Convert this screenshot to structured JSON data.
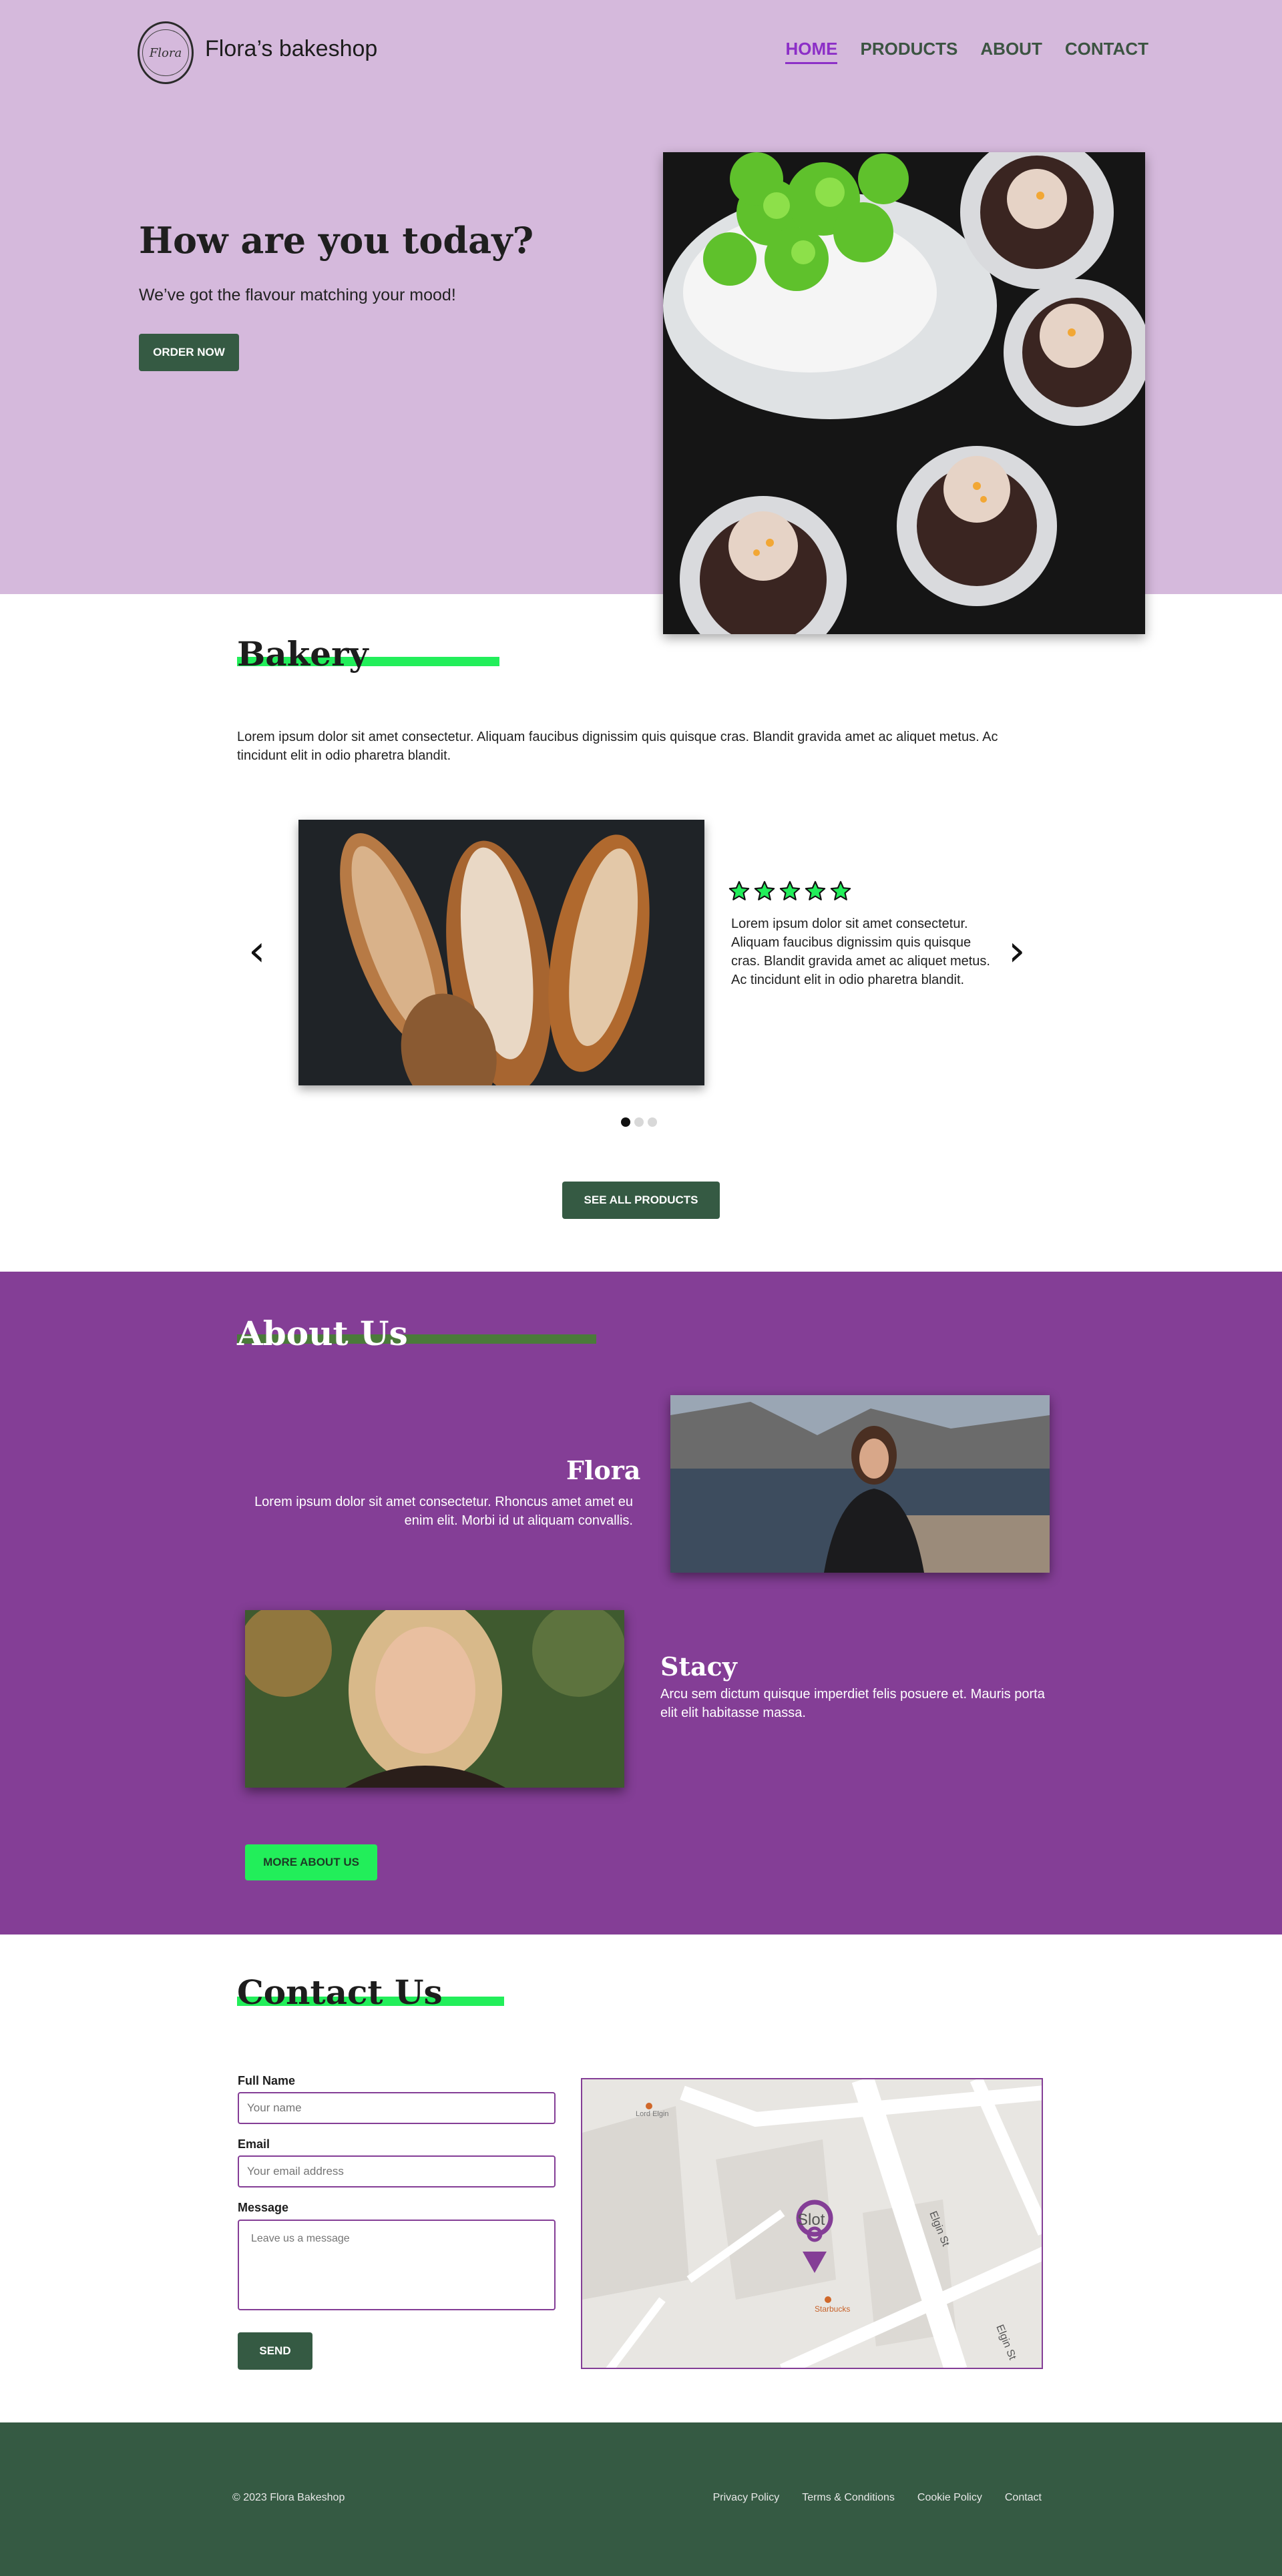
{
  "header": {
    "logo_text": "Flora",
    "brand": "Flora’s bakeshop",
    "nav": [
      "HOME",
      "PRODUCTS",
      "ABOUT",
      "CONTACT"
    ],
    "active_nav": "HOME"
  },
  "hero": {
    "title": "How are you today?",
    "subtitle": "We’ve got the flavour matching your mood!",
    "cta": "ORDER NOW"
  },
  "bakery": {
    "heading": "Bakery",
    "text": "Lorem ipsum dolor sit amet consectetur. Aliquam faucibus dignissim quis quisque cras. Blandit gravida amet ac aliquet metus. Ac tincidunt elit in odio pharetra blandit.",
    "review": {
      "rating": 5,
      "text": "Lorem ipsum dolor sit amet consectetur. Aliquam faucibus dignissim quis quisque cras. Blandit gravida amet ac aliquet metus. Ac tincidunt elit in odio pharetra blandit."
    },
    "slides_total": 3,
    "active_slide": 1,
    "see_all": "SEE ALL PRODUCTS"
  },
  "about": {
    "heading": "About Us",
    "people": [
      {
        "name": "Flora",
        "desc": "Lorem ipsum dolor sit amet consectetur. Rhoncus amet amet eu enim elit. Morbi id ut aliquam convallis."
      },
      {
        "name": "Stacy",
        "desc": "Arcu sem dictum quisque imperdiet felis posuere et. Mauris porta elit elit habitasse massa."
      }
    ],
    "more": "MORE ABOUT US"
  },
  "contact": {
    "heading": "Contact Us",
    "name_label": "Full Name",
    "name_placeholder": "Your name",
    "email_label": "Email",
    "email_placeholder": "Your email address",
    "message_label": "Message",
    "message_placeholder": "Leave us a message",
    "send": "SEND",
    "map": {
      "place": "Slot",
      "street": "Elgin St",
      "street2": "Elgin St",
      "poi": "Starbucks",
      "poi2": "Lord Elgin"
    }
  },
  "footer": {
    "copyright": "© 2023 Flora Bakeshop",
    "links": [
      "Privacy Policy",
      "Terms & Conditions",
      "Cookie Policy",
      "Contact"
    ]
  },
  "colors": {
    "hero_bg": "#d5b9dc",
    "about_bg": "#843e96",
    "accent_green": "#22ee5a",
    "dark_green": "#355a43",
    "nav_active": "#8c2fc7"
  }
}
